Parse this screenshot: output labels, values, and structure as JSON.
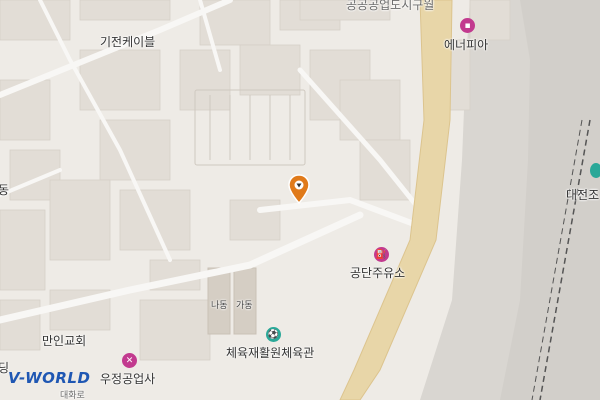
{
  "map": {
    "labels": {
      "kijeon_cable": "기전케이블",
      "energy_pia": "에너피아",
      "gongdan_gas": "공단주유소",
      "na_dong": "나동",
      "ga_dong": "가동",
      "manin_church": "만인교회",
      "sports_center": "체육재활원체육관",
      "ujeong_industry": "우정공업사",
      "daehwa_ro": "대화로",
      "daejeon_top": "대전조",
      "edge_dong": "동",
      "edge_ding": "딩",
      "top_partial": "공공공업도시구월"
    },
    "logo": "V-WORLD",
    "icons": {
      "pin": "location-pin-icon",
      "energy_pia": "shopping-bag-icon",
      "gongdan_gas": "fuel-station-icon",
      "sports_center": "sports-facility-icon",
      "ujeong_industry": "repair-tools-icon",
      "daejeon": "rail-station-icon"
    },
    "colors": {
      "background": "#eeebe6",
      "building": "#e2ddd6",
      "road": "#f8f7f5",
      "highway": "#e8d6a8",
      "railway_area": "#d6d3cf",
      "poi_shop": "#c23a8f",
      "poi_sport": "#2aa898",
      "pin": "#e07a1a"
    }
  }
}
